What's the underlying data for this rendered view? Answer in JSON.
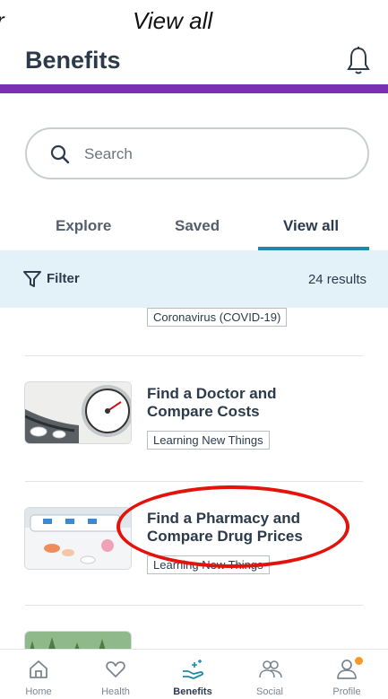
{
  "caption": {
    "left_text": "r",
    "right_text": "View all"
  },
  "header": {
    "title": "Benefits",
    "bell_icon": "bell-icon"
  },
  "search": {
    "placeholder": "Search",
    "icon": "search-icon"
  },
  "tabs": [
    {
      "label": "Explore"
    },
    {
      "label": "Saved"
    },
    {
      "label": "View all",
      "active": true
    }
  ],
  "filter": {
    "label": "Filter",
    "results": "24 results",
    "icon": "filter-icon"
  },
  "items": [
    {
      "tag": "Coronavirus (COVID-19)"
    },
    {
      "title_line1": "Find a Doctor and",
      "title_line2": "Compare Costs",
      "tag": "Learning New Things",
      "thumb_icon": "blood-pressure-gauge-image"
    },
    {
      "title_line1": "Find a Pharmacy and",
      "title_line2": "Compare Drug Prices",
      "tag": "Learning New Things",
      "thumb_icon": "pill-organizer-image"
    },
    {
      "thumb_icon": "forest-image"
    }
  ],
  "annotation": {
    "color": "#e3120b",
    "shape": "ellipse-around-pharmacy-title"
  },
  "bottom_nav": [
    {
      "label": "Home",
      "icon": "home-icon"
    },
    {
      "label": "Health",
      "icon": "heart-icon"
    },
    {
      "label": "Benefits",
      "icon": "hand-gift-icon",
      "active": true
    },
    {
      "label": "Social",
      "icon": "people-icon"
    },
    {
      "label": "Profile",
      "icon": "person-icon",
      "badge_color": "#f59a23"
    }
  ],
  "colors": {
    "brand_purple": "#7b2fb2",
    "accent_teal": "#1c8aa6",
    "filter_bg": "#e3f2f9",
    "text_dark": "#2c3a4b"
  }
}
